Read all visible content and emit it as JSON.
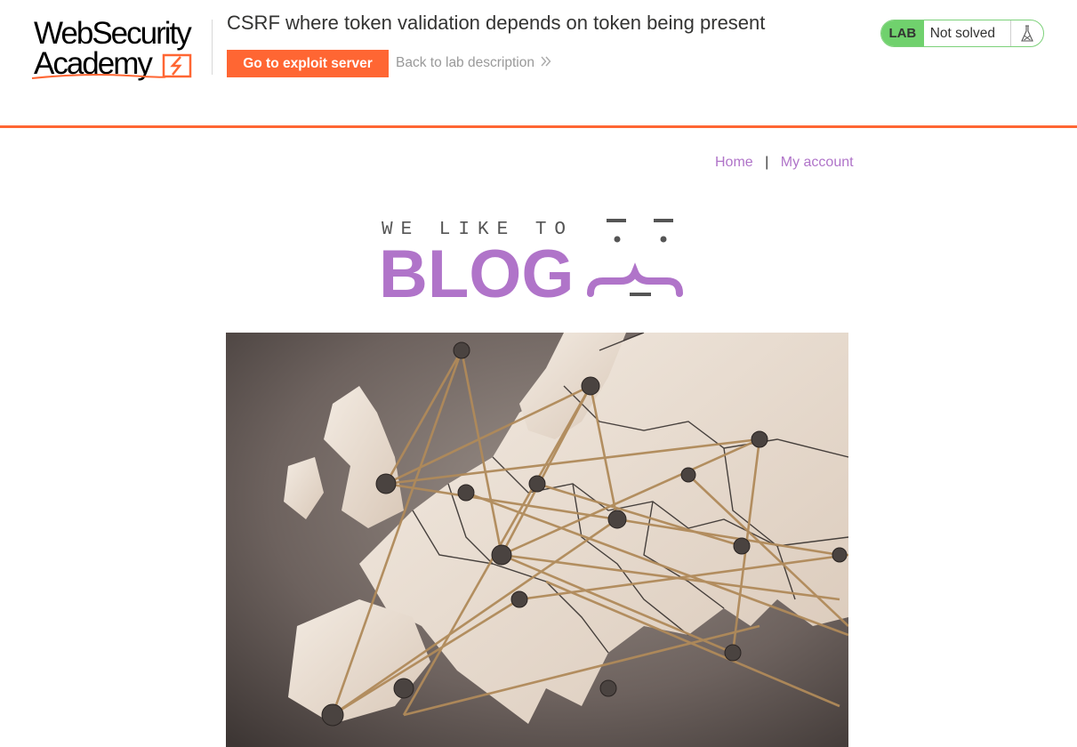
{
  "academy": {
    "logo_line1": "WebSecurity",
    "logo_line2": "Academy",
    "lab_title": "CSRF where token validation depends on token being present",
    "exploit_button": "Go to exploit server",
    "back_link": "Back to lab description",
    "status": {
      "tag": "LAB",
      "text": "Not solved",
      "tag_color": "#70d16d"
    },
    "accent_color": "#ff6633"
  },
  "nav": {
    "home": "Home",
    "separator": "|",
    "my_account": "My account",
    "link_color": "#b074c9"
  },
  "banner": {
    "top_text": "WE LIKE TO",
    "main_text": "BLOG",
    "color": "#b074c9"
  },
  "icons": {
    "flask": "flask-icon",
    "chevron": "double-chevron-right-icon",
    "logo_mark": "lightning-bracket-icon"
  }
}
